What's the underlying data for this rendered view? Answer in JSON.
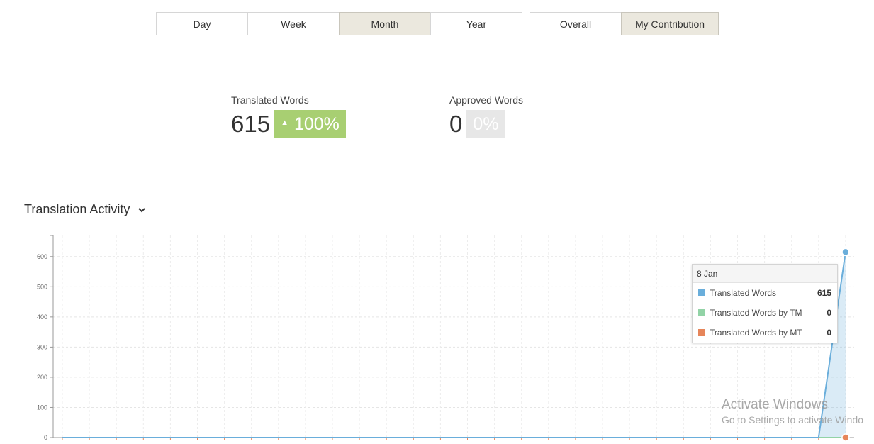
{
  "period_tabs": [
    {
      "label": "Day",
      "active": false
    },
    {
      "label": "Week",
      "active": false
    },
    {
      "label": "Month",
      "active": true
    },
    {
      "label": "Year",
      "active": false
    }
  ],
  "scope_tabs": [
    {
      "label": "Overall",
      "active": false
    },
    {
      "label": "My Contribution",
      "active": true
    }
  ],
  "metrics": {
    "translated": {
      "label": "Translated Words",
      "value": "615",
      "change": "100%",
      "direction": "up",
      "color": "#a8cf72"
    },
    "approved": {
      "label": "Approved Words",
      "value": "0",
      "change": "0%",
      "color": "#e7e7e7"
    }
  },
  "section": {
    "title": "Translation Activity",
    "icon": "chevron-down-icon"
  },
  "chart_data": {
    "type": "line",
    "title": "",
    "xlabel": "",
    "ylabel": "",
    "ylim": [
      0,
      670
    ],
    "yticks": [
      0,
      100,
      200,
      300,
      400,
      500,
      600
    ],
    "grid": true,
    "point_count": 30,
    "series": [
      {
        "name": "Translated Words",
        "color": "#6aaedb",
        "values": [
          0,
          0,
          0,
          0,
          0,
          0,
          0,
          0,
          0,
          0,
          0,
          0,
          0,
          0,
          0,
          0,
          0,
          0,
          0,
          0,
          0,
          0,
          0,
          0,
          0,
          0,
          0,
          0,
          0,
          615
        ]
      },
      {
        "name": "Translated Words by TM",
        "color": "#92d3a6",
        "values": [
          0,
          0,
          0,
          0,
          0,
          0,
          0,
          0,
          0,
          0,
          0,
          0,
          0,
          0,
          0,
          0,
          0,
          0,
          0,
          0,
          0,
          0,
          0,
          0,
          0,
          0,
          0,
          0,
          0,
          0
        ]
      },
      {
        "name": "Translated Words by MT",
        "color": "#e6855a",
        "values": [
          0,
          0,
          0,
          0,
          0,
          0,
          0,
          0,
          0,
          0,
          0,
          0,
          0,
          0,
          0,
          0,
          0,
          0,
          0,
          0,
          0,
          0,
          0,
          0,
          0,
          0,
          0,
          0,
          0,
          0
        ]
      }
    ]
  },
  "tooltip": {
    "date": "8 Jan",
    "rows": [
      {
        "label": "Translated Words",
        "value": "615",
        "color": "#6aaedb"
      },
      {
        "label": "Translated Words by TM",
        "value": "0",
        "color": "#92d3a6"
      },
      {
        "label": "Translated Words by MT",
        "value": "0",
        "color": "#e6855a"
      }
    ]
  },
  "watermark": {
    "line1": "Activate Windows",
    "line2": "Go to Settings to activate Windo"
  }
}
